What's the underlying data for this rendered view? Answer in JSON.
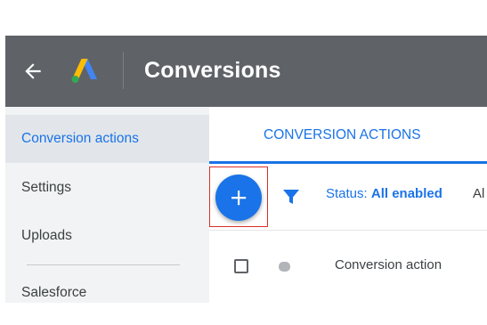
{
  "header": {
    "title": "Conversions",
    "back_icon": "arrow-left-icon",
    "logo": "google-ads-logo"
  },
  "sidebar": {
    "items": [
      {
        "label": "Conversion actions",
        "active": true
      },
      {
        "label": "Settings",
        "active": false
      },
      {
        "label": "Uploads",
        "active": false
      },
      {
        "label": "Salesforce",
        "active": false
      }
    ]
  },
  "tabs": [
    {
      "label": "CONVERSION ACTIONS",
      "active": true
    }
  ],
  "toolbar": {
    "add_icon": "plus-icon",
    "filter_icon": "filter-icon",
    "status_prefix": "Status: ",
    "status_value": "All enabled",
    "next_filter_truncated": "Al"
  },
  "table": {
    "columns": [
      "Conversion action"
    ]
  },
  "colors": {
    "header_bg": "#5f6368",
    "accent": "#1a73e8",
    "sidebar_bg": "#f1f3f4",
    "highlight_border": "#d93025"
  }
}
